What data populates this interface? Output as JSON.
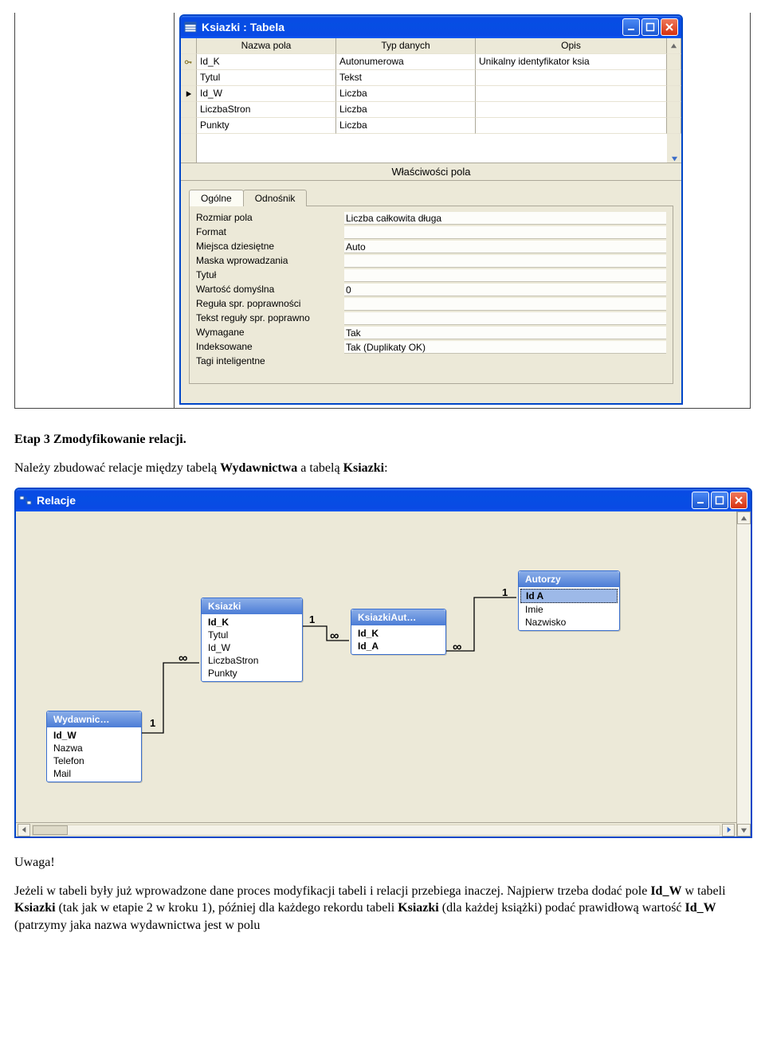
{
  "top_window": {
    "title": "Ksiazki : Tabela",
    "grid_headers": {
      "name": "Nazwa pola",
      "type": "Typ danych",
      "desc": "Opis"
    },
    "rows": [
      {
        "selector": "key",
        "name": "Id_K",
        "type": "Autonumerowa",
        "desc": "Unikalny identyfikator ksia"
      },
      {
        "selector": "",
        "name": "Tytul",
        "type": "Tekst",
        "desc": ""
      },
      {
        "selector": "tri",
        "name": "Id_W",
        "type": "Liczba",
        "desc": ""
      },
      {
        "selector": "",
        "name": "LiczbaStron",
        "type": "Liczba",
        "desc": ""
      },
      {
        "selector": "",
        "name": "Punkty",
        "type": "Liczba",
        "desc": ""
      }
    ],
    "section_label": "Właściwości pola",
    "tabs": {
      "general": "Ogólne",
      "lookup": "Odnośnik"
    },
    "props": [
      {
        "label": "Rozmiar pola",
        "value": "Liczba całkowita długa"
      },
      {
        "label": "Format",
        "value": ""
      },
      {
        "label": "Miejsca dziesiętne",
        "value": "Auto"
      },
      {
        "label": "Maska wprowadzania",
        "value": ""
      },
      {
        "label": "Tytuł",
        "value": ""
      },
      {
        "label": "Wartość domyślna",
        "value": "0"
      },
      {
        "label": "Reguła spr. poprawności",
        "value": ""
      },
      {
        "label": "Tekst reguły spr. poprawno",
        "value": ""
      },
      {
        "label": "Wymagane",
        "value": "Tak"
      },
      {
        "label": "Indeksowane",
        "value": "Tak (Duplikaty OK)"
      },
      {
        "label": "Tagi inteligentne",
        "value": ""
      }
    ]
  },
  "doc": {
    "heading": "Etap 3 Zmodyfikowanie relacji.",
    "p1_a": "Należy zbudować relacje między tabelą ",
    "p1_b": "Wydawnictwa",
    "p1_c": " a tabelą ",
    "p1_d": "Ksiazki",
    "p1_e": ":",
    "uwaga": "Uwaga!",
    "p2_a": "Jeżeli w tabeli były już wprowadzone dane proces modyfikacji tabeli i relacji przebiega inaczej. Najpierw trzeba dodać pole ",
    "p2_b": "Id_W",
    "p2_c": " w tabeli ",
    "p2_d": "Ksiazki",
    "p2_e": " (tak jak w etapie 2 w kroku 1), później dla każdego rekordu tabeli ",
    "p2_f": "Ksiazki",
    "p2_g": " (dla każdej książki) podać prawidłową wartość ",
    "p2_h": "Id_W",
    "p2_i": " (patrzymy jaka nazwa wydawnictwa jest w polu"
  },
  "rel_window": {
    "title": "Relacje",
    "tables": {
      "wydawnic": {
        "title": "Wydawnic…",
        "fields": [
          "Id_W",
          "Nazwa",
          "Telefon",
          "Mail"
        ],
        "pk": "Id_W"
      },
      "ksiazki": {
        "title": "Ksiazki",
        "fields": [
          "Id_K",
          "Tytul",
          "Id_W",
          "LiczbaStron",
          "Punkty"
        ],
        "pk": "Id_K"
      },
      "ksiazkiaut": {
        "title": "KsiazkiAut…",
        "fields": [
          "Id_K",
          "Id_A"
        ],
        "pk_all": true
      },
      "autorzy": {
        "title": "Autorzy",
        "fields": [
          "Id A",
          "Imie",
          "Nazwisko"
        ],
        "pk": "Id A",
        "sel": "Id A"
      }
    },
    "cardinality": {
      "one": "1",
      "many": "∞"
    }
  }
}
